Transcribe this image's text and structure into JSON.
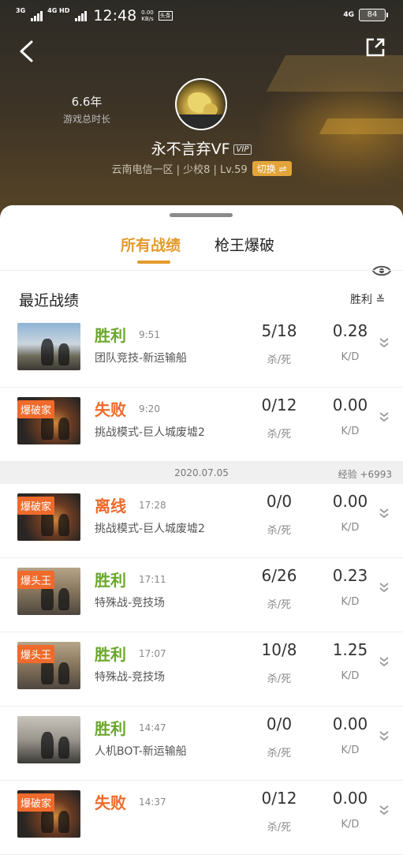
{
  "status_bar": {
    "sig1": "3G",
    "sig2": "4G HD",
    "time": "12:48",
    "speed_value": "0.00",
    "speed_unit": "KB/s",
    "tag": "头条",
    "net": "4G",
    "battery": "84"
  },
  "profile": {
    "play_years": "6.6年",
    "play_years_label": "游戏总时长",
    "name": "永不言弃VF",
    "vip": "VIP",
    "server_info": "云南电信一区 | 少校8 | Lv.59",
    "switch_label": "切换 ⇌"
  },
  "tabs": [
    {
      "label": "所有战绩",
      "active": true
    },
    {
      "label": "枪王爆破",
      "active": false
    }
  ],
  "section": {
    "title": "最近战绩",
    "filter": "胜利 ≚"
  },
  "colors": {
    "win": "#6aa62a",
    "loss": "#ef6a2b",
    "accent": "#e39a2c"
  },
  "matches": [
    {
      "badge": "",
      "result": "胜利",
      "result_type": "win",
      "time": "9:51",
      "mode": "团队竞技-新运输船",
      "kd_ratio": "5/18",
      "kd_ratio_label": "杀/死",
      "kd": "0.28",
      "kd_label": "K/D",
      "thumb": "ship"
    },
    {
      "badge": "爆破家",
      "result": "失败",
      "result_type": "loss",
      "time": "9:20",
      "mode": "挑战模式-巨人城废墟2",
      "kd_ratio": "0/12",
      "kd_ratio_label": "杀/死",
      "kd": "0.00",
      "kd_label": "K/D",
      "thumb": "ruins"
    }
  ],
  "date_bar": {
    "date": "2020.07.05",
    "exp": "经验 +6993"
  },
  "matches2": [
    {
      "badge": "爆破家",
      "result": "离线",
      "result_type": "loss",
      "time": "17:28",
      "mode": "挑战模式-巨人城废墟2",
      "kd_ratio": "0/0",
      "kd_ratio_label": "杀/死",
      "kd": "0.00",
      "kd_label": "K/D",
      "thumb": "ruins"
    },
    {
      "badge": "爆头王",
      "result": "胜利",
      "result_type": "win",
      "time": "17:11",
      "mode": "特殊战-竞技场",
      "kd_ratio": "6/26",
      "kd_ratio_label": "杀/死",
      "kd": "0.23",
      "kd_label": "K/D",
      "thumb": "arena"
    },
    {
      "badge": "爆头王",
      "result": "胜利",
      "result_type": "win",
      "time": "17:07",
      "mode": "特殊战-竞技场",
      "kd_ratio": "10/8",
      "kd_ratio_label": "杀/死",
      "kd": "1.25",
      "kd_label": "K/D",
      "thumb": "arena"
    },
    {
      "badge": "",
      "result": "胜利",
      "result_type": "win",
      "time": "14:47",
      "mode": "人机BOT-新运输船",
      "kd_ratio": "0/0",
      "kd_ratio_label": "杀/死",
      "kd": "0.00",
      "kd_label": "K/D",
      "thumb": "bot"
    },
    {
      "badge": "爆破家",
      "result": "失败",
      "result_type": "loss",
      "time": "14:37",
      "mode": "",
      "kd_ratio": "0/12",
      "kd_ratio_label": "杀/死",
      "kd": "0.00",
      "kd_label": "K/D",
      "thumb": "ruins"
    }
  ]
}
